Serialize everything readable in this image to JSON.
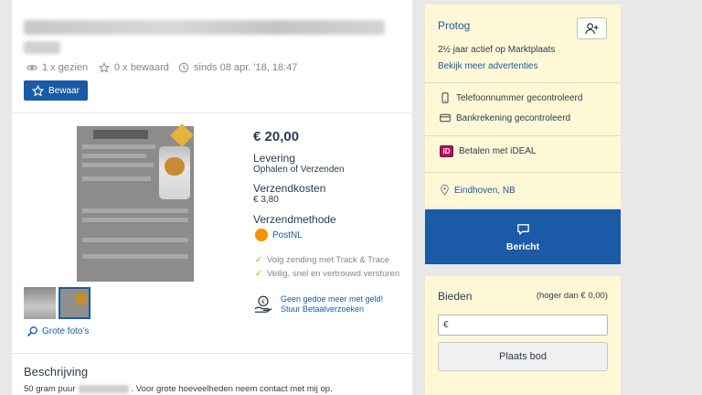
{
  "listing": {
    "views": "1 x gezien",
    "saves": "0 x bewaard",
    "since": "sinds 08 apr. '18, 18:47",
    "save_label": "Bewaar",
    "grote_fotos": "Grote foto's"
  },
  "details": {
    "price": "€ 20,00",
    "levering_label": "Levering",
    "levering_value": "Ophalen of Verzenden",
    "verzendkosten_label": "Verzendkosten",
    "verzendkosten_value": "€ 3,80",
    "verzendmethode_label": "Verzendmethode",
    "verzendmethode_value": "PostNL",
    "check1": "Volg zending met Track & Trace",
    "check2": "Veilig, snel en vertrouwd versturen",
    "payreq_line1": "Geen gedoe meer met geld!",
    "payreq_line2": "Stuur Betaalverzoeken"
  },
  "description": {
    "title": "Beschrijving",
    "text_start": "50 gram puur",
    "text_end": ". Voor grote hoeveelheden neem contact met mij op."
  },
  "seller": {
    "name": "Protog",
    "active": "2½ jaar actief op Marktplaats",
    "more_ads": "Bekijk meer advertenties",
    "phone_verified": "Telefoonnummer gecontroleerd",
    "bank_verified": "Bankrekening gecontroleerd",
    "ideal": "Betalen met iDEAL",
    "ideal_badge": "iD",
    "location": "Eindhoven, NB"
  },
  "message": {
    "label": "Bericht"
  },
  "bid": {
    "title": "Bieden",
    "minimum": "(hoger dan € 0,00)",
    "currency_prefix": "€",
    "button": "Plaats bod"
  },
  "colors": {
    "brand_blue": "#1a5aa6",
    "accent_orange": "#f39200",
    "seller_bg": "#fff8d6"
  }
}
